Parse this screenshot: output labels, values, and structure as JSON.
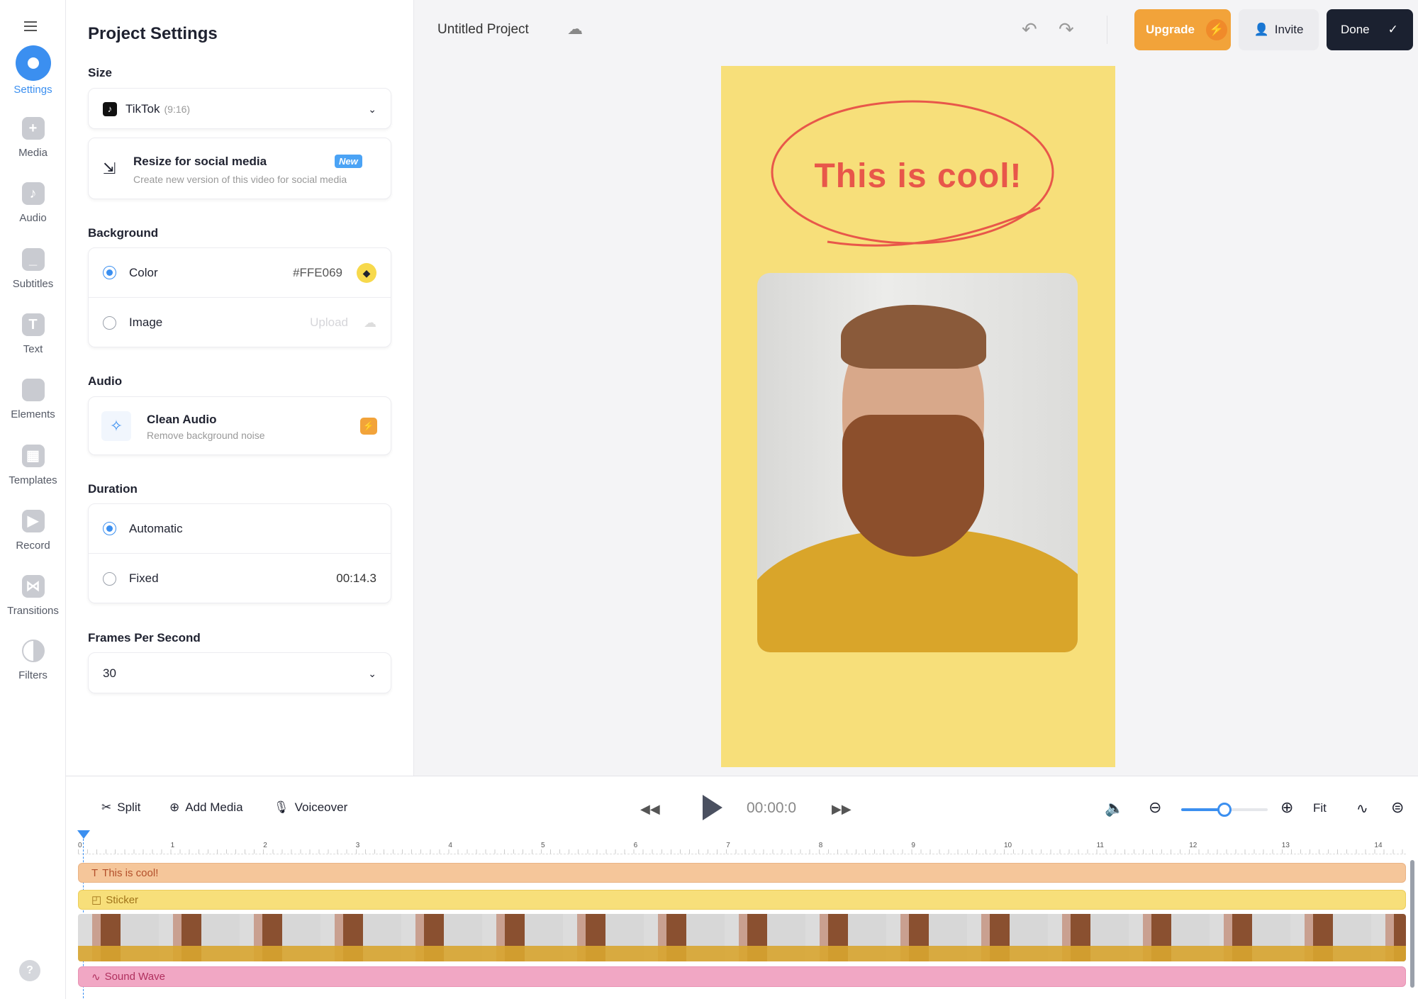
{
  "sidebar": {
    "items": [
      {
        "label": "Settings",
        "icon": "gear-icon",
        "active": true
      },
      {
        "label": "Media",
        "icon": "plus-icon"
      },
      {
        "label": "Audio",
        "icon": "music-note-icon"
      },
      {
        "label": "Subtitles",
        "icon": "subtitles-icon"
      },
      {
        "label": "Text",
        "icon": "text-icon"
      },
      {
        "label": "Elements",
        "icon": "sticker-icon"
      },
      {
        "label": "Templates",
        "icon": "templates-icon"
      },
      {
        "label": "Record",
        "icon": "camera-icon"
      },
      {
        "label": "Transitions",
        "icon": "transitions-icon"
      },
      {
        "label": "Filters",
        "icon": "filters-icon"
      }
    ],
    "help": "?"
  },
  "panel": {
    "title": "Project Settings",
    "size": {
      "label": "Size",
      "value": "TikTok",
      "ratio": "(9:16)"
    },
    "resize": {
      "title": "Resize for social media",
      "badge": "New",
      "subtitle": "Create new version of this video for social media"
    },
    "background": {
      "label": "Background",
      "color_label": "Color",
      "color_value": "#FFE069",
      "image_label": "Image",
      "upload": "Upload"
    },
    "audio": {
      "label": "Audio",
      "title": "Clean Audio",
      "subtitle": "Remove background noise"
    },
    "duration": {
      "label": "Duration",
      "automatic": "Automatic",
      "fixed": "Fixed",
      "fixed_value": "00:14.3"
    },
    "fps": {
      "label": "Frames Per Second",
      "value": "30"
    }
  },
  "header": {
    "project_title": "Untitled Project",
    "upgrade": "Upgrade",
    "invite": "Invite",
    "done": "Done"
  },
  "canvas": {
    "background": "#F7DF7A",
    "caption": "This is cool!"
  },
  "toolbar": {
    "split": "Split",
    "add_media": "Add Media",
    "voiceover": "Voiceover",
    "time": "00:00:0",
    "fit": "Fit",
    "zoom_level": 0.5
  },
  "timeline": {
    "ticks": [
      "0",
      "1",
      "2",
      "3",
      "4",
      "5",
      "6",
      "7",
      "8",
      "9",
      "10",
      "11",
      "12",
      "13",
      "14"
    ],
    "tracks": [
      {
        "label": "This is cool!",
        "color": "#F5C69A"
      },
      {
        "label": "Sticker",
        "color": "#F7DF7A"
      },
      {
        "label": "Sound Wave",
        "color": "#F1A7C4"
      }
    ]
  },
  "colors": {
    "accent": "#3B8FF0",
    "upgrade": "#F2A33A",
    "done": "#1B2130"
  }
}
